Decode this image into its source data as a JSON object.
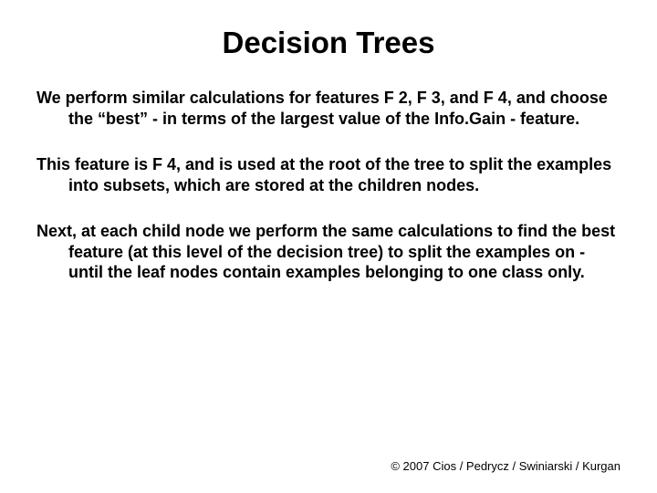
{
  "title": "Decision Trees",
  "paragraphs": {
    "p1": "We perform similar calculations for features F 2, F 3, and F 4, and choose the “best” - in terms of the largest value of the Info.Gain - feature.",
    "p2": "This feature is F 4, and is used at the root of the tree to split the examples into subsets, which are stored at the children nodes.",
    "p3": "Next, at each child node we perform the same calculations to find the best feature (at this level of the decision tree) to split the examples on - until the leaf nodes contain examples belonging to one class only."
  },
  "footer": "© 2007 Cios / Pedrycz / Swiniarski / Kurgan"
}
